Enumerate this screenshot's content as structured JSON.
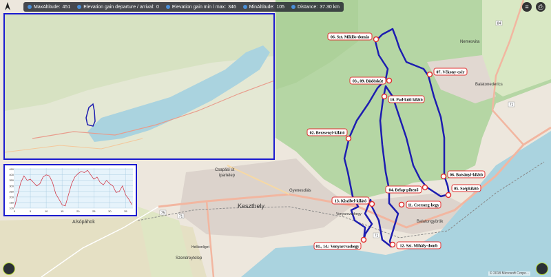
{
  "stats": {
    "max_altitude_label": "MaxAltitude:",
    "max_altitude_value": "451",
    "elev_gain_label": "Elevation gain departure / arrival:",
    "elev_gain_value": "0",
    "elev_minmax_label": "Elevation gain min / max:",
    "elev_minmax_value": "346",
    "min_altitude_label": "MinAltitude:",
    "min_altitude_value": "105",
    "distance_label": "Distance:",
    "distance_value": "37.30 km"
  },
  "buttons": {
    "menu_icon": "menu-icon",
    "print_icon": "printer-icon"
  },
  "waypoints": [
    {
      "id": "w06",
      "label": "06. Szt. Miklós-domás"
    },
    {
      "id": "w07",
      "label": "07. Vékony-csér"
    },
    {
      "id": "w03",
      "label": "03., 09. Büdöskút"
    },
    {
      "id": "w10",
      "label": "10. Pad-kúti kilátó"
    },
    {
      "id": "w02",
      "label": "02. Berzsenyi-kilátó"
    },
    {
      "id": "w06b",
      "label": "06. Batsányi-kilátó"
    },
    {
      "id": "w04",
      "label": "04. Belap-pihenő"
    },
    {
      "id": "w05",
      "label": "05. Szépkilátó"
    },
    {
      "id": "w13",
      "label": "13. Kiszibel-kilátó"
    },
    {
      "id": "w11",
      "label": "11. Cserszeg-hegy"
    },
    {
      "id": "w01",
      "label": "01., 14.: Vonyarcvashegy"
    },
    {
      "id": "w12",
      "label": "12. Szt. Mihály-domb"
    }
  ],
  "place_labels": {
    "gyenesdias": "Gyenesdiás",
    "keszthely": "Keszthely",
    "csapasi": "Csapási út",
    "ipartelep": "ipartelep",
    "alsopahok": "Alsópáhok",
    "balatongyorok": "Balatongyörök",
    "balatonederics": "Balatonederics",
    "nemesvita": "Nemesvita",
    "szendreytelep": "Szendreytelep",
    "helikonliget": "Helikonliget",
    "vonyarcvashegy": "Vonyarcvashegy"
  },
  "road_numbers": {
    "r71a": "71",
    "r71b": "71",
    "r71c": "71",
    "r84": "84",
    "r75": "75"
  },
  "profile_chart": {
    "chart_data": {
      "type": "area",
      "x": [
        0,
        1,
        2,
        3,
        4,
        5,
        6,
        7,
        8,
        9,
        10,
        11,
        12,
        13,
        14,
        15,
        16,
        17,
        18,
        19,
        20,
        21,
        22,
        23,
        24,
        25,
        26,
        27,
        28,
        29,
        30,
        31,
        32,
        33,
        34,
        35,
        36,
        37
      ],
      "values": [
        105,
        220,
        330,
        390,
        350,
        360,
        330,
        300,
        320,
        380,
        400,
        390,
        330,
        230,
        180,
        130,
        120,
        220,
        320,
        380,
        410,
        430,
        420,
        440,
        400,
        360,
        380,
        330,
        310,
        350,
        320,
        300,
        240,
        250,
        300,
        220,
        180,
        130
      ],
      "x_ticks": [
        "0",
        "5",
        "10",
        "15",
        "20",
        "25",
        "30",
        "35"
      ],
      "y_ticks": [
        "100",
        "150",
        "200",
        "250",
        "300",
        "350",
        "400",
        "450"
      ],
      "xlim": [
        0,
        37.3
      ],
      "ylim": [
        100,
        460
      ],
      "grid": true
    }
  },
  "attribution": "© 2018 Microsoft Corpo..."
}
